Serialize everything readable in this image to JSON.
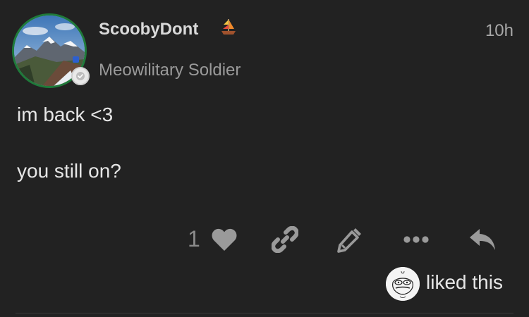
{
  "post": {
    "username": "ScoobyDont",
    "user_title": "Meowilitary Soldier",
    "timestamp": "10h",
    "body": [
      "im back <3",
      "you still on?"
    ],
    "like_count": "1",
    "liked_text": "liked this"
  },
  "icons": {
    "avatar": "mountain-avatar",
    "flair": "check-circle-icon",
    "user_badge": "sailboat-icon",
    "like": "heart-icon",
    "link": "link-icon",
    "edit": "pencil-icon",
    "more": "ellipsis-icon",
    "reply": "reply-icon",
    "liker": "troll-face-avatar"
  },
  "colors": {
    "background": "#222222",
    "avatar_ring": "#1f7a3a",
    "icon": "#9a9a9a"
  }
}
